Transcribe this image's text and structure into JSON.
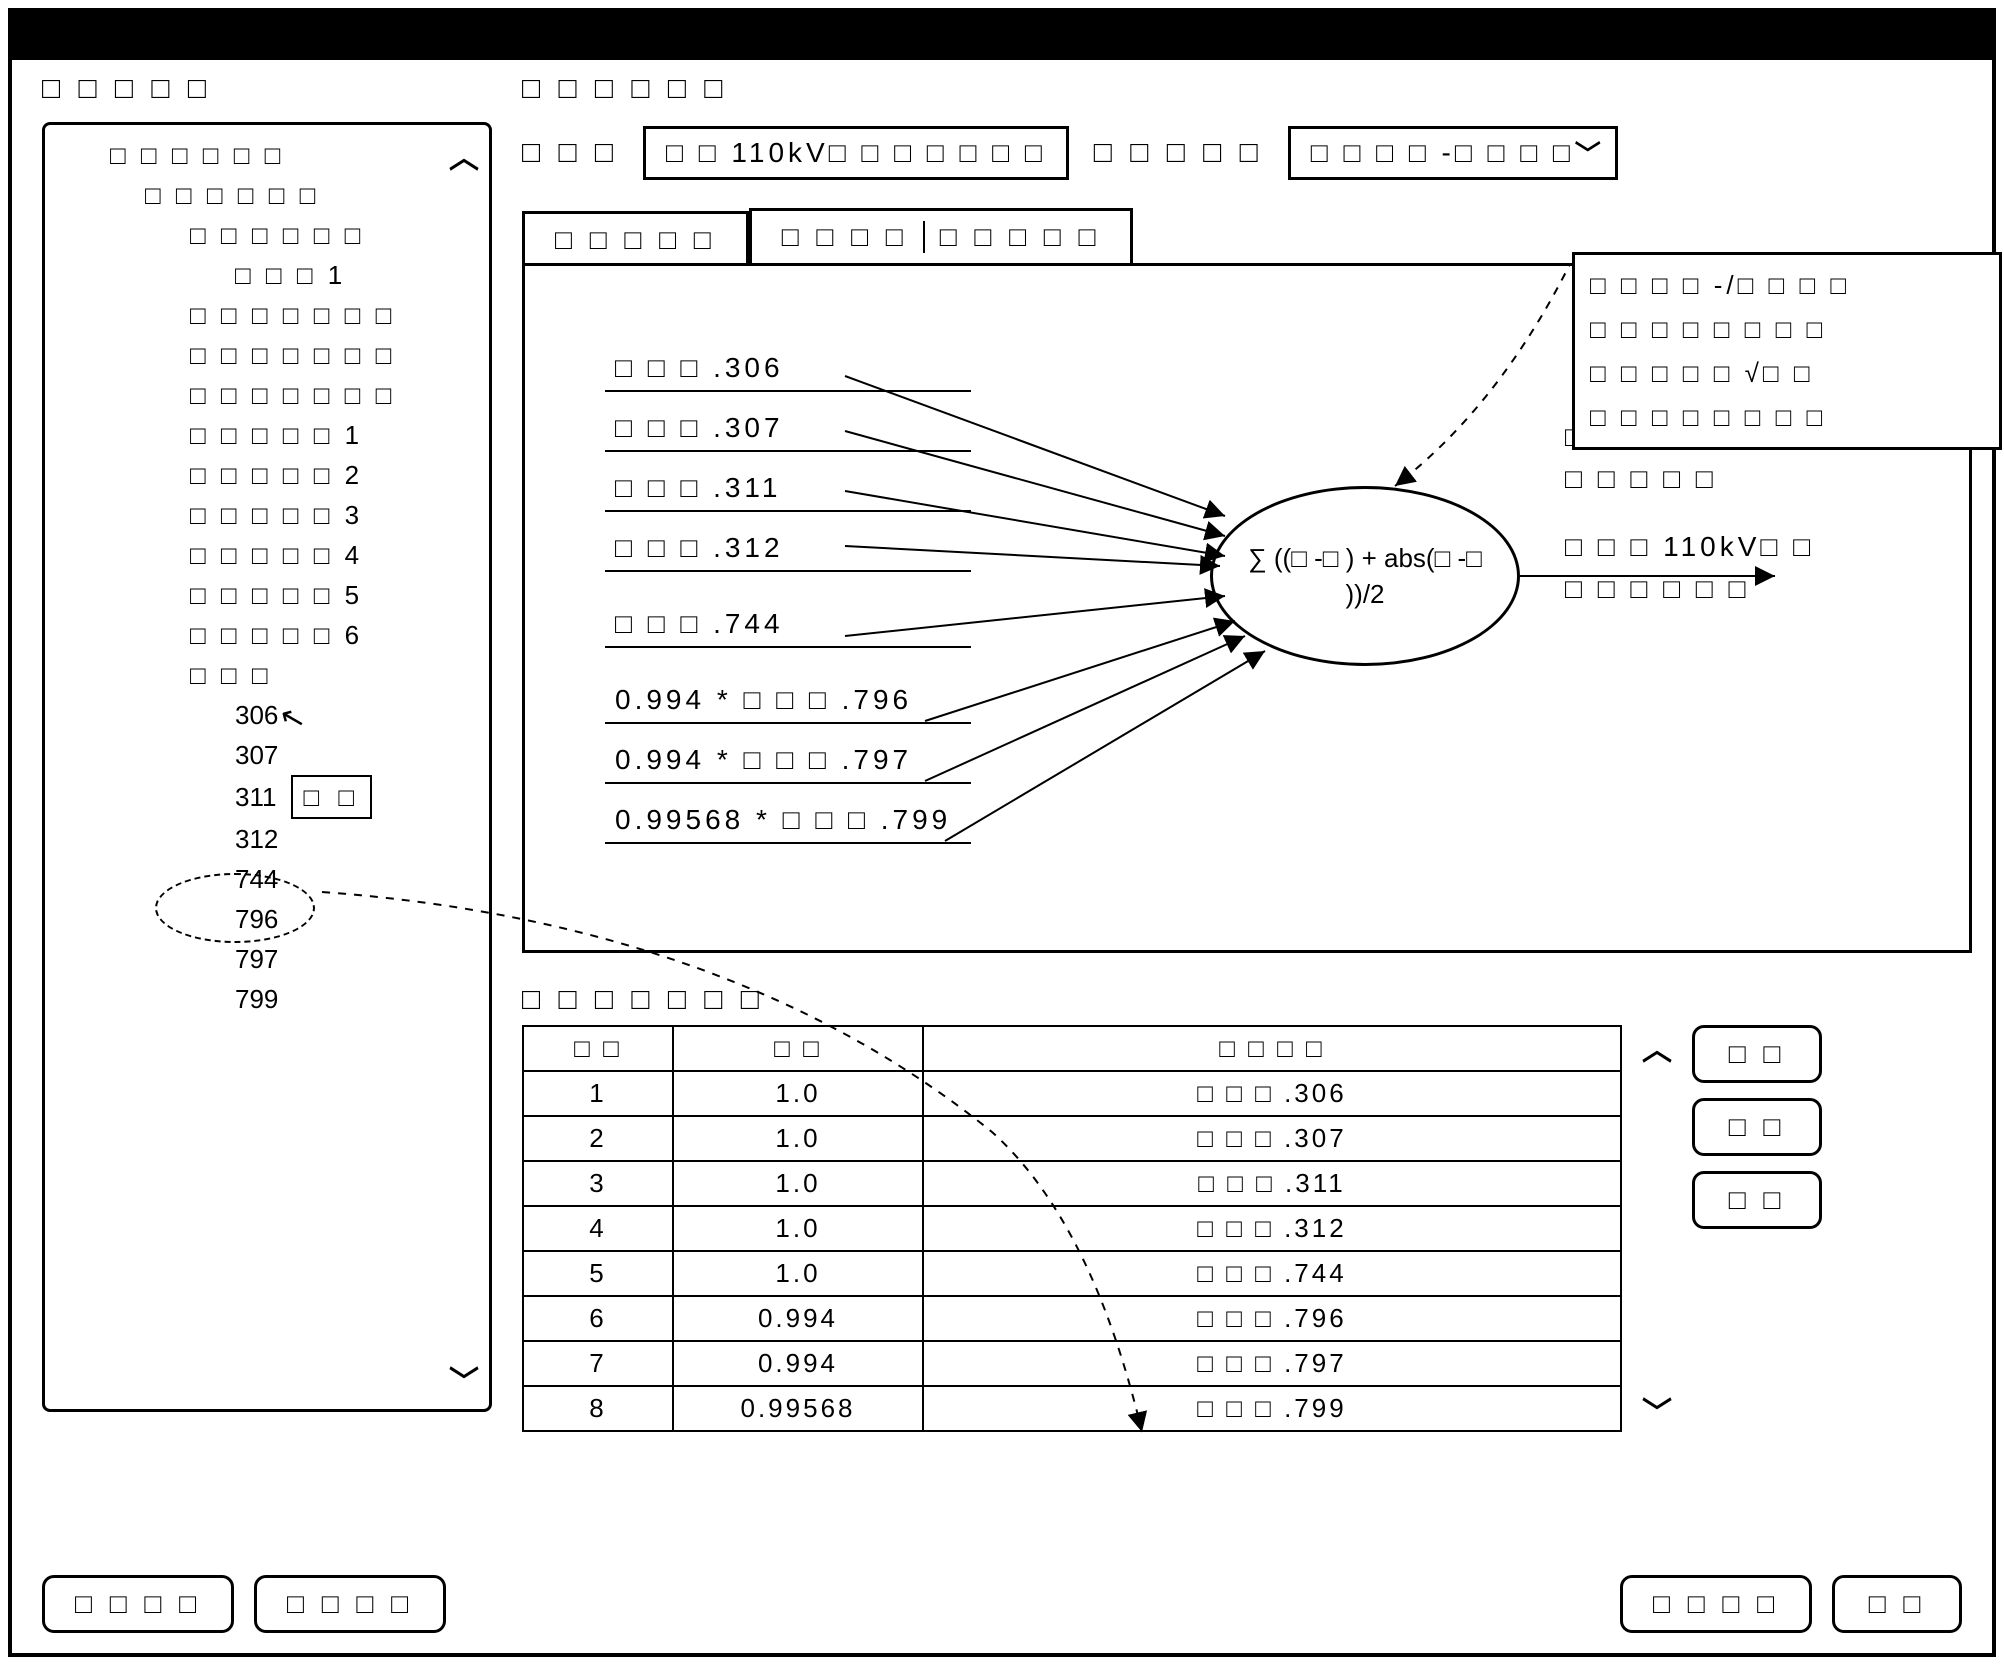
{
  "tree": {
    "label": "□ □ □ □ □",
    "root": "□ □ □ □ □ □",
    "lvl2": "□ □ □ □ □ □",
    "lvl3": "□ □ □ □ □ □",
    "lvl4a": "□ □ □ 1",
    "lvl3b": "□ □ □ □ □ □ □",
    "lvl3c": "□ □ □ □ □ □ □",
    "lvl3d": "□ □ □ □ □ □ □",
    "m1": "□ □ □ □ □ 1",
    "m2": "□ □ □ □ □ 2",
    "m3": "□ □ □ □ □ 3",
    "m4": "□ □ □ □ □ 4",
    "m5": "□ □ □ □ □ 5",
    "m6": "□ □ □ □ □ 6",
    "sub": "□ □ □",
    "n306": "306",
    "n307": "307",
    "n311": "311",
    "n312": "312",
    "n744": "744",
    "n796": "796",
    "n797": "797",
    "n799": "799",
    "tooltip": "□ □"
  },
  "right": {
    "label": "□ □ □ □ □ □",
    "field1_label": "□ □ □",
    "field1_value": "□ □ 110kV□ □ □ □ □ □ □",
    "field2_label": "□ □ □ □ □",
    "dropdown_selected": "□ □ □ □ -□ □ □ □",
    "dropdown_items": [
      "□ □ □ □ -/□ □ □ □",
      "□ □ □ □ □ □ □ □",
      "□ □ □ □ □ √□ □",
      "□ □ □ □ □ □ □ □"
    ]
  },
  "tabs": {
    "tab1": "□ □ □ □ □",
    "tab2a": "□ □ □ □",
    "tab2b": "□ □ □ □ □"
  },
  "diagram": {
    "inputs": [
      "□ □ □ .306",
      "□ □ □ .307",
      "□ □ □ .311",
      "□ □ □ .312",
      "□ □ □ .744",
      "0.994 * □ □ □ .796",
      "0.994 * □ □ □ .797",
      "0.99568 * □ □ □ .799"
    ],
    "formula": "∑ ((□ -□ ) + abs(□ -□ ))/2",
    "dashed_label1": "□ □ □ □ □",
    "dashed_label2": "□ □ □ □ □",
    "output1": "□ □ □ 110kV□ □",
    "output2": "□ □ □ □ □ □"
  },
  "table": {
    "label": "□ □ □ □ □ □ □",
    "header_seq": "□ □",
    "header_coef": "□ □",
    "header_meter": "□ □ □ □",
    "rows": [
      {
        "seq": "1",
        "coef": "1.0",
        "meter": "□ □ □ .306"
      },
      {
        "seq": "2",
        "coef": "1.0",
        "meter": "□ □ □ .307"
      },
      {
        "seq": "3",
        "coef": "1.0",
        "meter": "□ □ □ .311"
      },
      {
        "seq": "4",
        "coef": "1.0",
        "meter": "□ □ □ .312"
      },
      {
        "seq": "5",
        "coef": "1.0",
        "meter": "□ □ □ .744"
      },
      {
        "seq": "6",
        "coef": "0.994",
        "meter": "□ □ □ .796"
      },
      {
        "seq": "7",
        "coef": "0.994",
        "meter": "□ □ □ .797"
      },
      {
        "seq": "8",
        "coef": "0.99568",
        "meter": "□ □ □ .799"
      }
    ]
  },
  "buttons": {
    "side1": "□ □",
    "side2": "□ □",
    "side3": "□ □",
    "bottom_left1": "□ □ □ □",
    "bottom_left2": "□ □ □ □",
    "bottom_right1": "□ □ □ □",
    "bottom_right2": "□ □"
  }
}
